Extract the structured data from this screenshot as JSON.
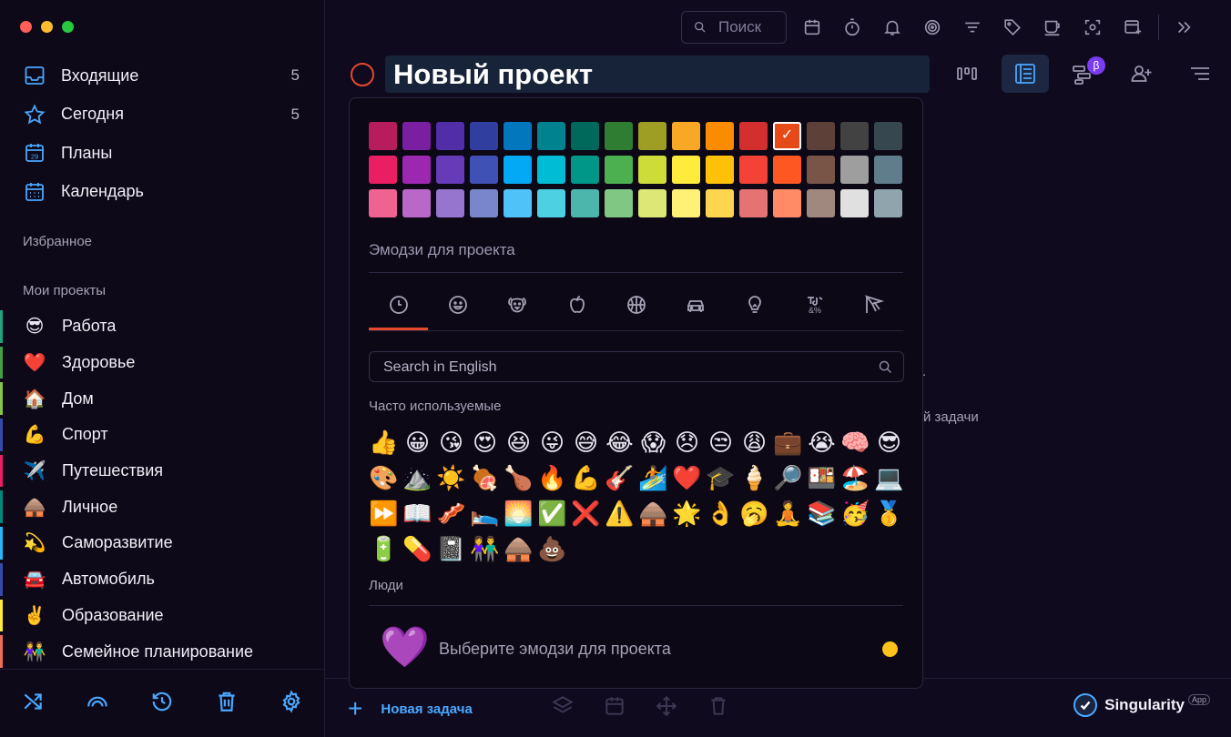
{
  "sidebar": {
    "traffic_colors": [
      "#ff5f57",
      "#febc2e",
      "#28c840"
    ],
    "nav": [
      {
        "label": "Входящие",
        "count": "5",
        "icon": "inbox-icon"
      },
      {
        "label": "Сегодня",
        "count": "5",
        "icon": "star-icon"
      },
      {
        "label": "Планы",
        "count": "",
        "icon": "plans-calendar-icon",
        "badge": "29"
      },
      {
        "label": "Календарь",
        "count": "",
        "icon": "calendar-grid-icon"
      }
    ],
    "favorites_title": "Избранное",
    "projects_title": "Мои проекты",
    "projects": [
      {
        "emoji": "😎",
        "label": "Работа",
        "color": "#1fa37a"
      },
      {
        "emoji": "❤️",
        "label": "Здоровье",
        "color": "#43a047"
      },
      {
        "emoji": "🏠",
        "label": "Дом",
        "color": "#8bc34a"
      },
      {
        "emoji": "💪",
        "label": "Спорт",
        "color": "#3949ab"
      },
      {
        "emoji": "✈️",
        "label": "Путешествия",
        "color": "#e91e63"
      },
      {
        "emoji": "🛖",
        "label": "Личное",
        "color": "#00897b"
      },
      {
        "emoji": "💫",
        "label": "Саморазвитие",
        "color": "#29b6f6"
      },
      {
        "emoji": "🚘",
        "label": "Автомобиль",
        "color": "#3949ab"
      },
      {
        "emoji": "✌️",
        "label": "Образование",
        "color": "#ffeb3b"
      },
      {
        "emoji": "👫",
        "label": "Семейное планирование",
        "color": "#ef6c5a"
      }
    ]
  },
  "toolbar": {
    "search_placeholder": "Поиск"
  },
  "project": {
    "title": "Новый проект",
    "circle_color": "#e6482b"
  },
  "popup": {
    "palette": [
      [
        "#b71c5c",
        "#7b1fa2",
        "#512da8",
        "#303f9f",
        "#0277bd",
        "#00838f",
        "#00695c",
        "#2e7d32",
        "#9e9d24",
        "#f9a825",
        "#fb8c00",
        "#d32f2f",
        "#e64a19",
        "#5d4037",
        "#424242",
        "#37474f"
      ],
      [
        "#e91e63",
        "#9c27b0",
        "#673ab7",
        "#3f51b5",
        "#03a9f4",
        "#00bcd4",
        "#009688",
        "#4caf50",
        "#cddc39",
        "#ffeb3b",
        "#ffc107",
        "#f44336",
        "#ff5722",
        "#795548",
        "#9e9e9e",
        "#607d8b"
      ],
      [
        "#f06292",
        "#ba68c8",
        "#9575cd",
        "#7986cb",
        "#4fc3f7",
        "#4dd0e1",
        "#4db6ac",
        "#81c784",
        "#dce775",
        "#fff176",
        "#ffd54f",
        "#e57373",
        "#ff8a65",
        "#a1887f",
        "#e0e0e0",
        "#90a4ae"
      ]
    ],
    "selected_row": 0,
    "selected_col": 12,
    "emoji_caption": "Эмодзи для проекта",
    "categories": [
      "recent-clock-icon",
      "smiley-icon",
      "animal-icon",
      "food-apple-icon",
      "ball-icon",
      "car-icon",
      "lightbulb-icon",
      "symbols-icon",
      "flag-icon"
    ],
    "active_category": 0,
    "search_placeholder": "Search in English",
    "frequent_title": "Часто используемые",
    "frequent": [
      "👍",
      "😀",
      "😘",
      "😍",
      "😆",
      "😜",
      "😅",
      "😂",
      "😱",
      "😞",
      "😒",
      "😩",
      "💼",
      "😭",
      "🧠",
      "😎",
      "🎨",
      "⛰️",
      "☀️",
      "🍖",
      "🍗",
      "🔥",
      "💪",
      "🎸",
      "🏄",
      "❤️",
      "🎓",
      "🍦",
      "🔎",
      "🍱",
      "🏖️",
      "💻",
      "⏩",
      "📖",
      "🥓",
      "🛌",
      "🌅",
      "✅",
      "❌",
      "⚠️",
      "🛖",
      "🌟",
      "👌",
      "🥱",
      "🧘",
      "📚",
      "🥳",
      "🥇",
      "🔋",
      "💊",
      "📓",
      "👫",
      "🛖",
      "💩"
    ],
    "people_title": "Люди",
    "preview_emoji": "💜",
    "preview_label": "Выберите эмодзи для проекта",
    "skin_tone_color": "#fcc21b"
  },
  "main": {
    "hint_text": "й задачи",
    "hint_dot": ".",
    "new_task_label": "Новая задача"
  },
  "brand": {
    "name": "Singularity",
    "badge": "App"
  }
}
